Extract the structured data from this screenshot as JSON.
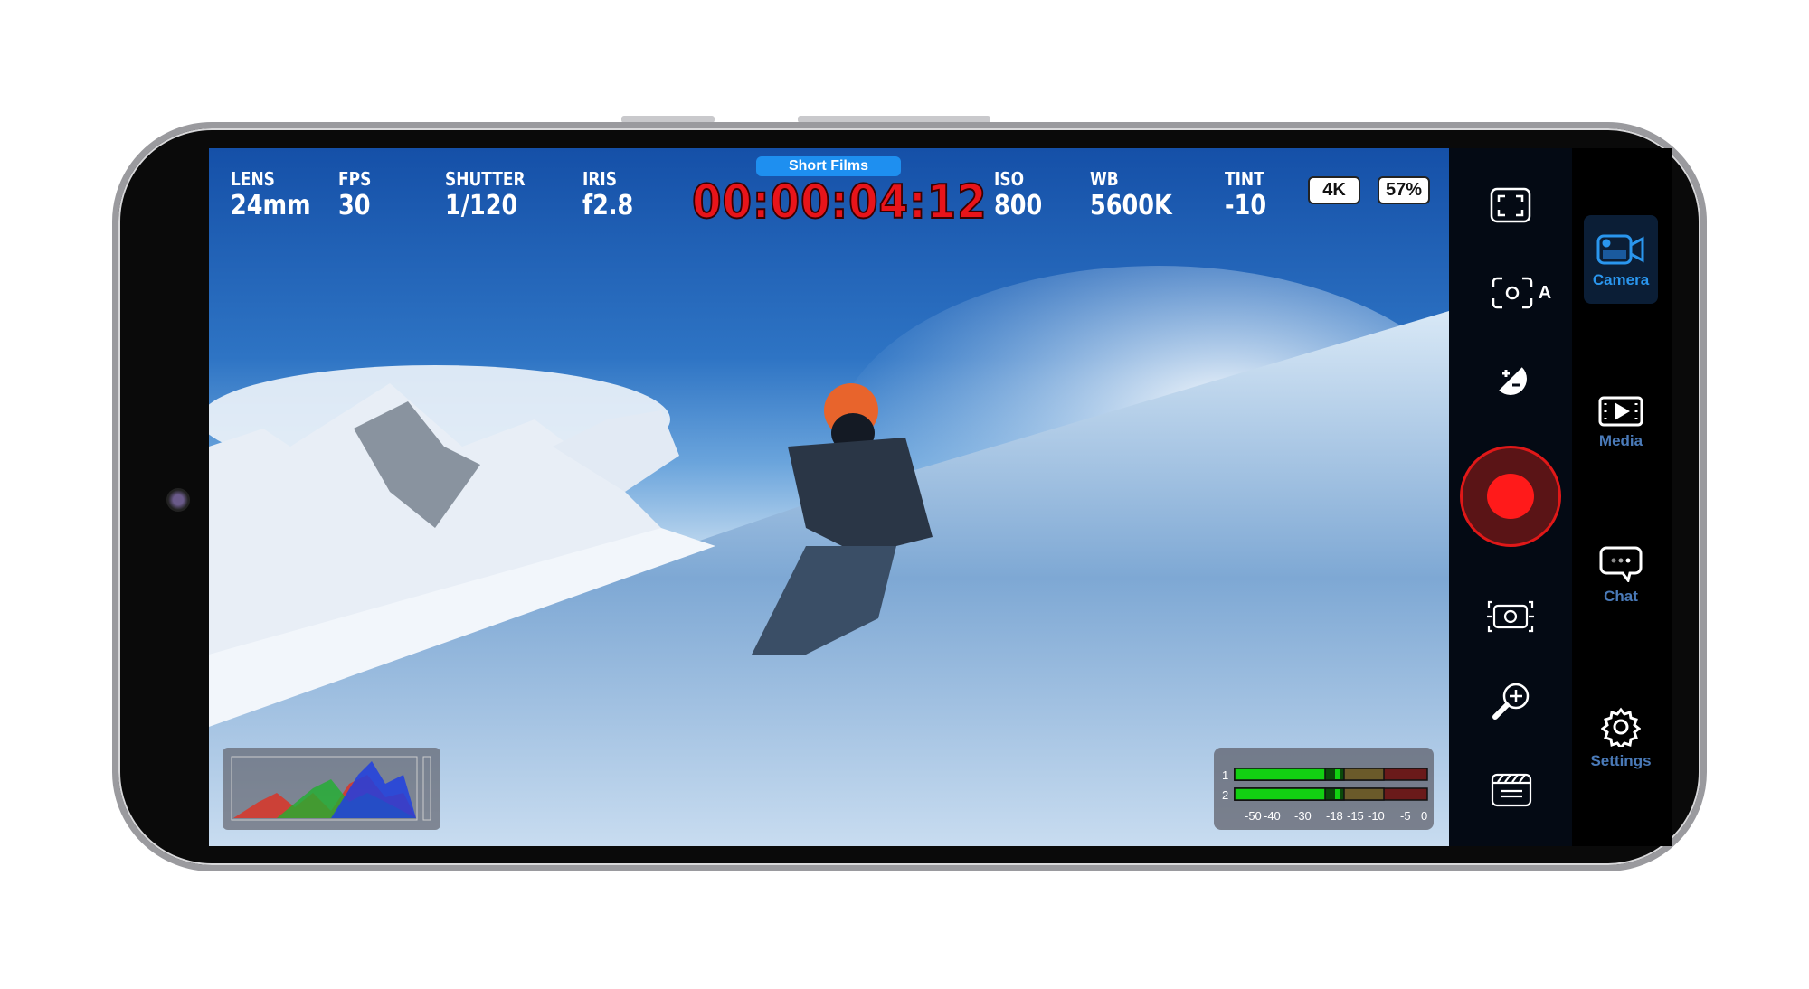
{
  "status_bar": {
    "lens": {
      "label": "LENS",
      "value": "24mm"
    },
    "fps": {
      "label": "FPS",
      "value": "30"
    },
    "shutter": {
      "label": "SHUTTER",
      "value": "1/120"
    },
    "iris": {
      "label": "IRIS",
      "value": "f2.8"
    },
    "project": "Short Films",
    "timecode": "00:00:04:12",
    "iso": {
      "label": "ISO",
      "value": "800"
    },
    "wb": {
      "label": "WB",
      "value": "5600K"
    },
    "tint": {
      "label": "TINT",
      "value": "-10"
    },
    "resolution": "4K",
    "battery": "57%"
  },
  "controls": {
    "icons": [
      "frame-guides-icon",
      "auto-focus-icon",
      "exposure-icon",
      "record-button",
      "stabilization-icon",
      "zoom-icon",
      "slate-icon"
    ],
    "focus_mode": "A",
    "record_color": "#ff1a1a"
  },
  "nav": {
    "items": [
      {
        "label": "Camera",
        "icon": "video-camera-icon",
        "active": true
      },
      {
        "label": "Media",
        "icon": "film-play-icon",
        "active": false
      },
      {
        "label": "Chat",
        "icon": "chat-bubble-icon",
        "active": false
      },
      {
        "label": "Settings",
        "icon": "gear-icon",
        "active": false
      }
    ],
    "accent": "#2a96ee"
  },
  "audio_meter": {
    "channels": [
      "1",
      "2"
    ],
    "scale": [
      "-50",
      "-40",
      "-30",
      "-18",
      "-15",
      "-10",
      "-5",
      "0"
    ]
  }
}
